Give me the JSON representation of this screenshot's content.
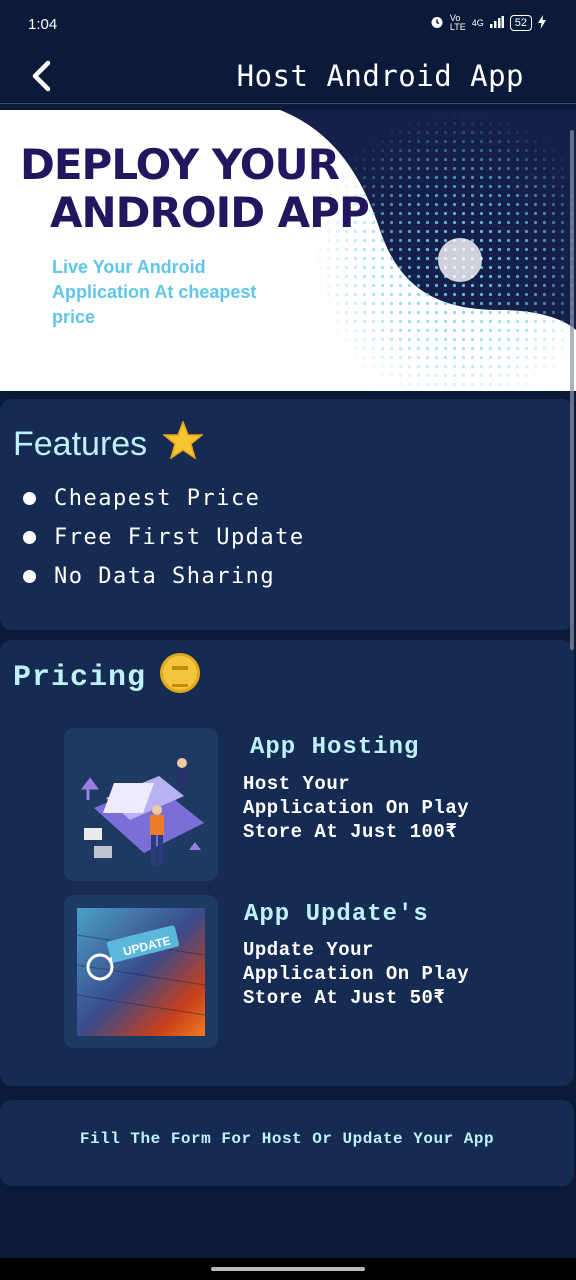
{
  "status_bar": {
    "time": "1:04",
    "network": "4G",
    "battery": "52"
  },
  "app_bar": {
    "back_icon": "chevron-left-icon",
    "title": "Host Android App"
  },
  "banner": {
    "title_line1": "DEPLOY YOUR",
    "title_line2": "ANDROID APP",
    "subtitle": "Live Your Android Application At cheapest price"
  },
  "features": {
    "title": "Features",
    "title_icon": "star-icon",
    "items": [
      "Cheapest Price",
      "Free First Update",
      "No Data Sharing"
    ]
  },
  "pricing": {
    "title": "Pricing",
    "title_icon": "coin-icon",
    "plans": [
      {
        "name": "App Hosting",
        "description": "Host Your Application On Play Store At Just 100₹"
      },
      {
        "name": "App Update's",
        "description": "Update Your Application On Play Store At Just 50₹"
      }
    ],
    "update_image_label": "UPDATE"
  },
  "cta": {
    "text": "Fill The Form For Host Or Update Your App"
  },
  "colors": {
    "background": "#0c1a3a",
    "card": "#152b52",
    "accent_text": "#bff1fb",
    "banner_title": "#23155e",
    "banner_subtitle": "#5fc6e8"
  }
}
